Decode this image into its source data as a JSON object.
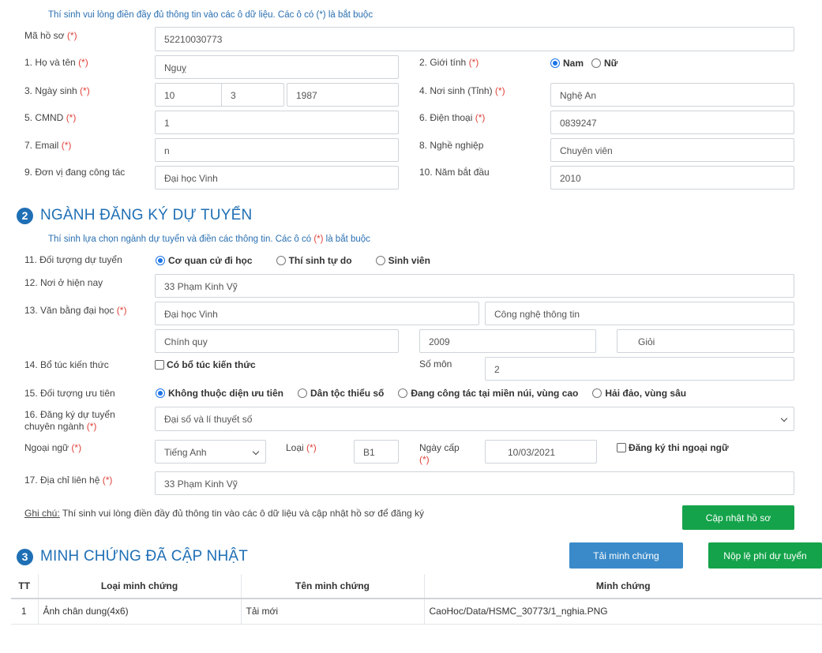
{
  "section1": {
    "note": "Thí sinh vui lòng điền đầy đủ thông tin vào các ô dữ liệu. Các ô có (*) là bắt buộc",
    "ma_ho_so": {
      "label": "Mã hồ sơ",
      "req": "(*)",
      "value": "52210030773"
    },
    "ho_ten": {
      "label": "1. Họ và tên",
      "req": "(*)",
      "value": "Nguỵ"
    },
    "gioi_tinh": {
      "label": "2. Giới tính",
      "req": "(*)",
      "options": [
        "Nam",
        "Nữ"
      ],
      "selected": "Nam"
    },
    "ngay_sinh": {
      "label": "3. Ngày sinh",
      "req": "(*)",
      "day": "10",
      "month": "3",
      "year": "1987"
    },
    "noi_sinh": {
      "label": "4. Nơi sinh (Tỉnh)",
      "req": "(*)",
      "value": "Nghệ An"
    },
    "cmnd": {
      "label": "5. CMND",
      "req": "(*)",
      "value": "1"
    },
    "dien_thoai": {
      "label": "6. Điện thoại",
      "req": "(*)",
      "value": "0839247"
    },
    "email": {
      "label": "7. Email",
      "req": "(*)",
      "value": "n"
    },
    "nghe_nghiep": {
      "label": "8. Nghề nghiệp",
      "value": "Chuyên viên"
    },
    "don_vi": {
      "label": "9. Đơn vị đang công tác",
      "value": "Đại học Vinh"
    },
    "nam_bat_dau": {
      "label": "10. Năm bắt đầu",
      "value": "2010"
    }
  },
  "section2": {
    "number": "2",
    "title": "NGÀNH ĐĂNG KÝ DỰ TUYỂN",
    "note_a": "Thí sinh lựa chọn ngành dự tuyển và điền các thông tin. Các ô có ",
    "note_req": "(*)",
    "note_b": " là bắt buộc",
    "doi_tuong": {
      "label": "11. Đối tượng dự tuyển",
      "options": [
        "Cơ quan cử đi học",
        "Thí sinh tự do",
        "Sinh viên"
      ],
      "selected": "Cơ quan cử đi học"
    },
    "noi_o": {
      "label": "12. Nơi ở hiện nay",
      "value": "33 Phạm Kinh Vỹ"
    },
    "van_bang": {
      "label": "13. Văn bằng đại học",
      "req": "(*)",
      "truong": "Đại học Vinh",
      "nganh": "Công nghệ thông tin",
      "he": "Chính quy",
      "nam": "2009",
      "xep_loai": "Giỏi"
    },
    "bo_tuc": {
      "label": "14. Bổ túc kiến thức",
      "checkbox_label": "Có bổ túc kiến thức",
      "checked": false,
      "so_mon_label": "Số môn",
      "so_mon": "2"
    },
    "uu_tien": {
      "label": "15. Đối tượng ưu tiên",
      "options": [
        "Không thuộc diện ưu tiên",
        "Dân tộc thiểu số",
        "Đang công tác tại miền núi, vùng cao",
        "Hải đảo, vùng sâu"
      ],
      "selected": "Không thuộc diện ưu tiên"
    },
    "chuyen_nganh": {
      "label_1": "16. Đăng ký dự tuyển",
      "label_2": "chuyên ngành",
      "req": "(*)",
      "value": "Đại số và lí thuyết số"
    },
    "ngoai_ngu": {
      "label": "Ngoại ngữ",
      "req": "(*)",
      "value": "Tiếng Anh",
      "loai_label": "Loại",
      "loai_req": "(*)",
      "loai": "B1",
      "ngay_cap_label": "Ngày cấp",
      "ngay_cap_req": "(*)",
      "ngay_cap": "10/03/2021",
      "dang_ky_label": "Đăng ký thi ngoại ngữ",
      "dang_ky_checked": false
    },
    "dia_chi": {
      "label": "17. Địa chỉ liên hệ",
      "req": "(*)",
      "value": "33 Phạm Kinh Vỹ"
    },
    "ghi_chu_label": "Ghi chú:",
    "ghi_chu_text": " Thí sinh vui lòng điền đầy đủ thông tin vào các ô dữ liệu và cập nhật hồ sơ để đăng ký",
    "update_button": "Cập nhật hồ sơ"
  },
  "section3": {
    "number": "3",
    "title": "MINH CHỨNG ĐÃ CẬP NHẬT",
    "upload_button": "Tải minh chứng",
    "fee_button": "Nộp lệ phí dự tuyển",
    "columns": [
      "TT",
      "Loại minh chứng",
      "Tên minh chứng",
      "Minh chứng"
    ],
    "rows": [
      {
        "tt": "1",
        "loai": "Ảnh chân dung(4x6)",
        "ten": "Tải mới",
        "file": "CaoHoc/Data/HSMC_30773/1_nghia.PNG"
      }
    ]
  },
  "colors": {
    "accent": "#1f6fb5",
    "required": "#e0423a",
    "green_button": "#14a34a",
    "blue_button": "#3a8ac9",
    "link": "#2a6fb0"
  }
}
